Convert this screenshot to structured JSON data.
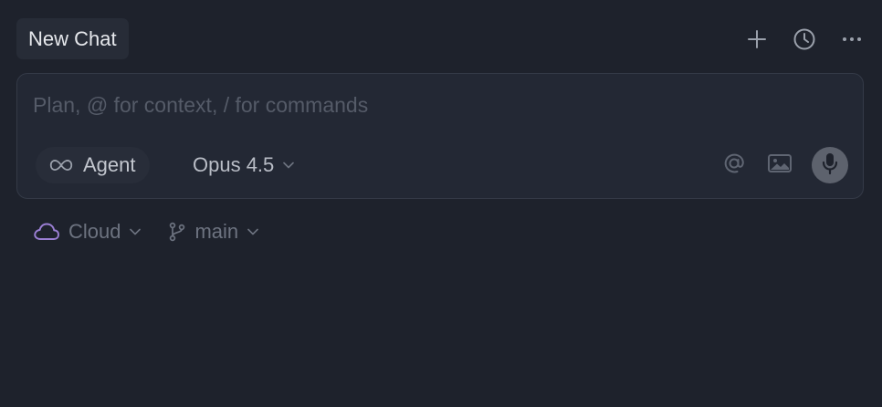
{
  "header": {
    "tab_label": "New Chat",
    "actions": [
      {
        "icon": "plus-icon",
        "label": "New chat"
      },
      {
        "icon": "history-icon",
        "label": "History"
      },
      {
        "icon": "more-icon",
        "label": "More"
      }
    ]
  },
  "composer": {
    "placeholder": "Plan, @ for context, / for commands",
    "value": "",
    "mode": {
      "icon": "infinity-icon",
      "label": "Agent"
    },
    "model": {
      "label": "Opus 4.5"
    },
    "tools": [
      {
        "icon": "at-mention-icon"
      },
      {
        "icon": "image-icon"
      },
      {
        "icon": "microphone-icon"
      }
    ]
  },
  "footer": {
    "environment": {
      "icon": "cloud-icon",
      "label": "Cloud",
      "accent": "#9b7fd4"
    },
    "branch": {
      "icon": "git-branch-icon",
      "label": "main"
    }
  },
  "colors": {
    "background": "#1e222c",
    "panel": "#232834",
    "tab": "#272c37",
    "mic_button": "#5d626d"
  }
}
